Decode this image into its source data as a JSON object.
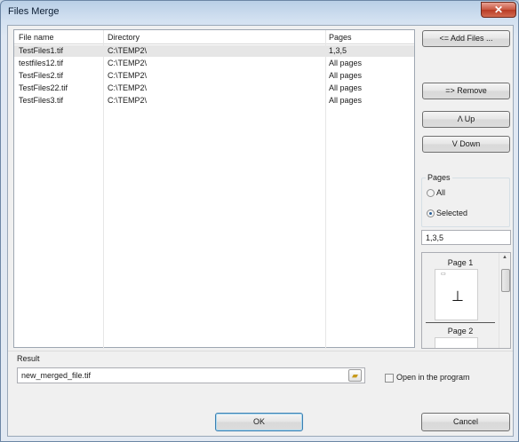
{
  "window": {
    "title": "Files Merge",
    "close_glyph": "✕"
  },
  "file_list": {
    "columns": [
      "File name",
      "Directory",
      "Pages"
    ],
    "rows": [
      {
        "name": "TestFiles1.tif",
        "dir": "C:\\TEMP2\\",
        "pages": "1,3,5",
        "selected": true
      },
      {
        "name": "testfiles12.tif",
        "dir": "C:\\TEMP2\\",
        "pages": "All pages",
        "selected": false
      },
      {
        "name": "TestFiles2.tif",
        "dir": "C:\\TEMP2\\",
        "pages": "All pages",
        "selected": false
      },
      {
        "name": "TestFiles22.tif",
        "dir": "C:\\TEMP2\\",
        "pages": "All pages",
        "selected": false
      },
      {
        "name": "TestFiles3.tif",
        "dir": "C:\\TEMP2\\",
        "pages": "All pages",
        "selected": false
      }
    ]
  },
  "buttons": {
    "add_files": "<= Add Files ...",
    "remove": "=> Remove",
    "up": "Λ Up",
    "down": "V Down",
    "ok": "OK",
    "cancel": "Cancel"
  },
  "pages_group": {
    "title": "Pages",
    "option_all": "All",
    "option_selected": "Selected",
    "selected_option": "Selected",
    "pages_value": "1,3,5"
  },
  "thumbnails": {
    "page1_label": "Page 1",
    "page2_label": "Page 2",
    "page1_glyph": "⊥"
  },
  "result": {
    "label": "Result",
    "value": "new_merged_file.tif",
    "open_in_program_label": "Open in the program",
    "open_in_program_checked": false
  },
  "colors": {
    "selection": "#e6e6e6",
    "close_button": "#c8553e",
    "default_button_border": "#3c7fb1"
  }
}
